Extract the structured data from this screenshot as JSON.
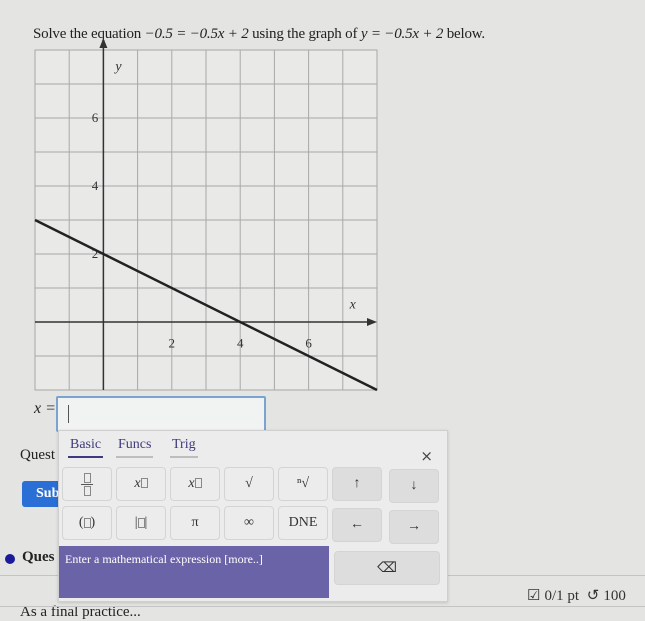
{
  "question": {
    "prompt_prefix": "Solve the equation",
    "equation": "−0.5 = −0.5x + 2",
    "prompt_middle": "using the graph of",
    "function": "y = −0.5x + 2",
    "prompt_suffix": "below."
  },
  "chart_data": {
    "type": "line",
    "title": "",
    "xlabel": "x",
    "ylabel": "y",
    "xlim": [
      -2,
      8
    ],
    "ylim": [
      -2,
      8
    ],
    "grid": true,
    "x_ticks": [
      2,
      4,
      6
    ],
    "y_ticks": [
      2,
      4,
      6
    ],
    "series": [
      {
        "name": "y = -0.5x + 2",
        "x": [
          -2,
          8
        ],
        "y": [
          3,
          -2
        ]
      }
    ]
  },
  "answer": {
    "label": "x =",
    "value": ""
  },
  "keypad": {
    "tabs": [
      {
        "label": "Basic",
        "active": true
      },
      {
        "label": "Funcs",
        "active": false
      },
      {
        "label": "Trig",
        "active": false
      }
    ],
    "close_label": "×",
    "row1": [
      "fraction",
      "x^□",
      "x_□",
      "√",
      "ⁿ√",
      "↑",
      "↓"
    ],
    "row2": [
      "(□)",
      "|□|",
      "π",
      "∞",
      "DNE",
      "←",
      "→"
    ],
    "backspace": "⌫",
    "tooltip": "Enter a mathematical expression [more..]"
  },
  "page": {
    "quest_label": "Quest",
    "submit_label": "Sub",
    "ques_label": "Ques",
    "score": "0/1 pt",
    "retries": "100",
    "final_text": "As a final practice..."
  },
  "colors": {
    "accent": "#3e3a7e",
    "submit": "#2a6fd6",
    "tooltip": "#6b63a8",
    "input_border": "#7aa3cf"
  }
}
